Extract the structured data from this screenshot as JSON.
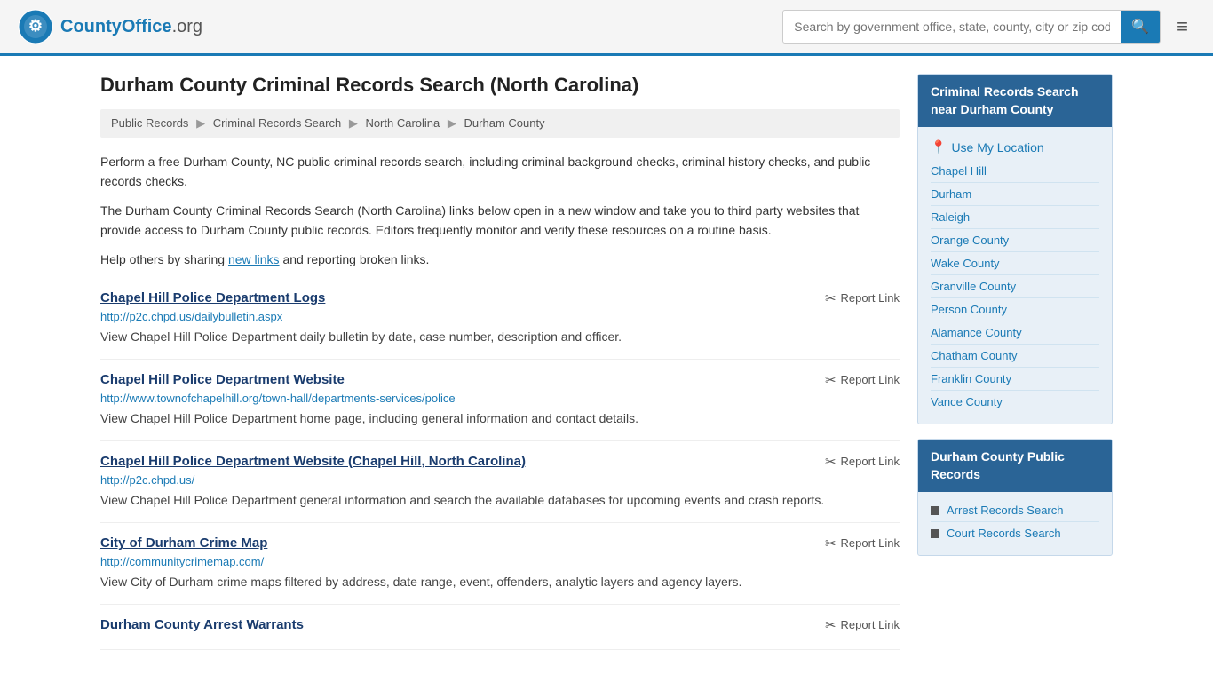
{
  "header": {
    "logo_text": "CountyOffice",
    "logo_suffix": ".org",
    "search_placeholder": "Search by government office, state, county, city or zip code",
    "menu_icon": "≡"
  },
  "page": {
    "title": "Durham County Criminal Records Search (North Carolina)",
    "breadcrumbs": [
      {
        "label": "Public Records",
        "href": "#"
      },
      {
        "label": "Criminal Records Search",
        "href": "#"
      },
      {
        "label": "North Carolina",
        "href": "#"
      },
      {
        "label": "Durham County",
        "href": "#"
      }
    ],
    "description1": "Perform a free Durham County, NC public criminal records search, including criminal background checks, criminal history checks, and public records checks.",
    "description2": "The Durham County Criminal Records Search (North Carolina) links below open in a new window and take you to third party websites that provide access to Durham County public records. Editors frequently monitor and verify these resources on a routine basis.",
    "description3_prefix": "Help others by sharing ",
    "description3_link": "new links",
    "description3_suffix": " and reporting broken links."
  },
  "results": [
    {
      "title": "Chapel Hill Police Department Logs",
      "url": "http://p2c.chpd.us/dailybulletin.aspx",
      "description": "View Chapel Hill Police Department daily bulletin by date, case number, description and officer.",
      "report_label": "Report Link"
    },
    {
      "title": "Chapel Hill Police Department Website",
      "url": "http://www.townofchapelhill.org/town-hall/departments-services/police",
      "description": "View Chapel Hill Police Department home page, including general information and contact details.",
      "report_label": "Report Link"
    },
    {
      "title": "Chapel Hill Police Department Website (Chapel Hill, North Carolina)",
      "url": "http://p2c.chpd.us/",
      "description": "View Chapel Hill Police Department general information and search the available databases for upcoming events and crash reports.",
      "report_label": "Report Link"
    },
    {
      "title": "City of Durham Crime Map",
      "url": "http://communitycrimemap.com/",
      "description": "View City of Durham crime maps filtered by address, date range, event, offenders, analytic layers and agency layers.",
      "report_label": "Report Link"
    },
    {
      "title": "Durham County Arrest Warrants",
      "url": "",
      "description": "",
      "report_label": "Report Link"
    }
  ],
  "sidebar": {
    "nearby_title": "Criminal Records Search near Durham County",
    "use_my_location": "Use My Location",
    "nearby_links": [
      {
        "label": "Chapel Hill"
      },
      {
        "label": "Durham"
      },
      {
        "label": "Raleigh"
      },
      {
        "label": "Orange County"
      },
      {
        "label": "Wake County"
      },
      {
        "label": "Granville County"
      },
      {
        "label": "Person County"
      },
      {
        "label": "Alamance County"
      },
      {
        "label": "Chatham County"
      },
      {
        "label": "Franklin County"
      },
      {
        "label": "Vance County"
      }
    ],
    "public_records_title": "Durham County Public Records",
    "public_records_links": [
      {
        "label": "Arrest Records Search"
      },
      {
        "label": "Court Records Search"
      }
    ]
  }
}
